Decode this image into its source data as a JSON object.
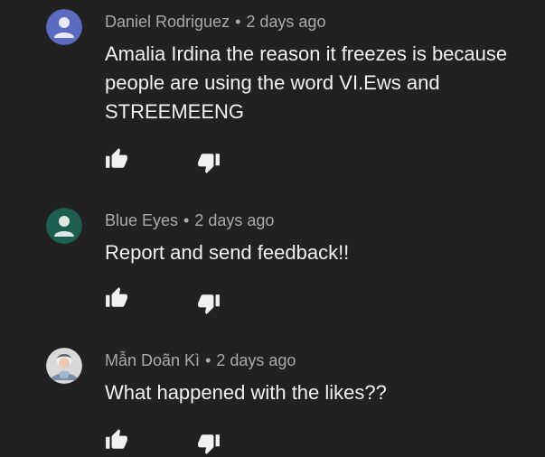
{
  "comments": [
    {
      "author": "Daniel Rodriguez",
      "separator": "•",
      "time": "2 days ago",
      "text": "Amalia Irdina the reason it freezes is because people are using the word VI.Ews and STREEMEENG",
      "avatar_color": "#5c6bc0",
      "avatar_icon": "default-person-icon"
    },
    {
      "author": "Blue Eyes",
      "separator": "•",
      "time": "2 days ago",
      "text": "Report and send feedback!!",
      "avatar_color": "#1e5e4e",
      "avatar_icon": "default-person-icon"
    },
    {
      "author": "Mẫn Doãn Kì",
      "separator": "•",
      "time": "2 days ago",
      "text": "What happened with the likes??",
      "avatar_color": "#d9d9d9",
      "avatar_icon": "photo-avatar"
    }
  ],
  "icons": {
    "like": "thumb-up-icon",
    "dislike": "thumb-down-icon"
  },
  "colors": {
    "background": "#212121",
    "text": "#f1f1f1",
    "meta": "#aaaaaa"
  }
}
